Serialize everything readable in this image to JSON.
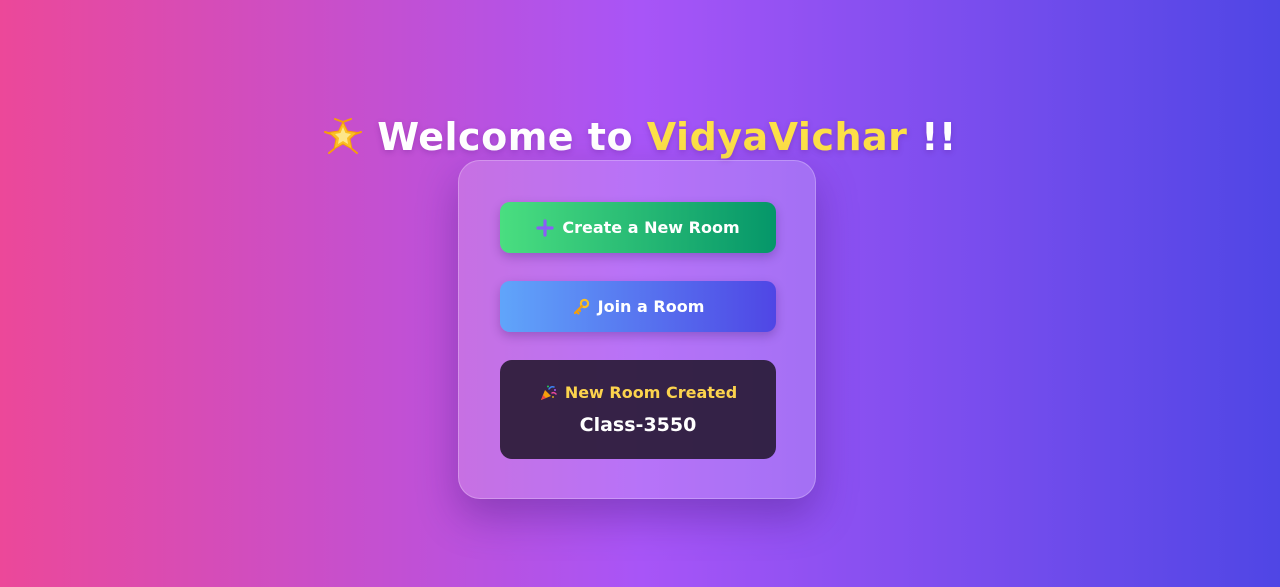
{
  "header": {
    "prefix": "Welcome to ",
    "brand": "VidyaVichar",
    "suffix": " !!",
    "icon": "glowing-star-icon"
  },
  "actions": {
    "create_label": "Create a New Room",
    "create_icon": "plus-icon",
    "join_label": "Join a Room",
    "join_icon": "key-icon"
  },
  "result": {
    "icon": "party-popper-icon",
    "label": "New Room Created",
    "room_code": "Class-3550"
  },
  "colors": {
    "brand": "#fde047",
    "create_button": "#10b981",
    "join_button": "#6366f1",
    "result_label": "#fcd34d"
  }
}
